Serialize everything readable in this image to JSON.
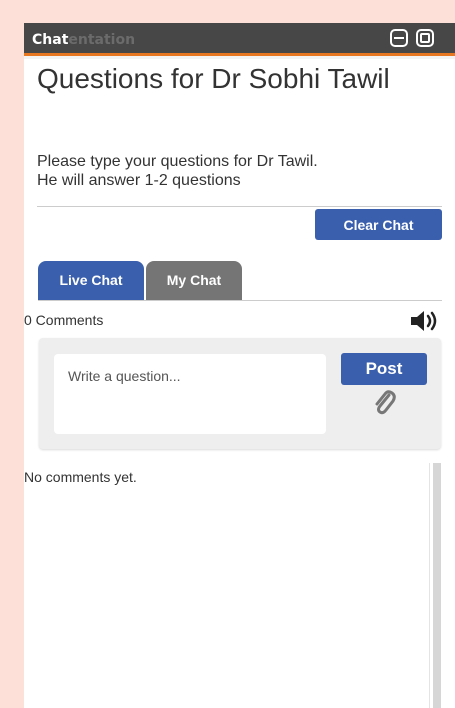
{
  "window": {
    "tab_label": "Chat",
    "tab_label_hidden": "entation",
    "minimize_icon": "minimize-icon",
    "maximize_icon": "maximize-icon"
  },
  "header": {
    "title": "Questions for Dr Sobhi Tawil",
    "description_line1": "Please type your questions for Dr Tawil.",
    "description_line2": "He will answer 1-2 questions"
  },
  "actions": {
    "clear_label": "Clear Chat"
  },
  "tabs": [
    {
      "label": "Live Chat",
      "active": true,
      "color": "#3a5fad"
    },
    {
      "label": "My Chat",
      "active": false,
      "color": "#757575"
    }
  ],
  "comments": {
    "count_text": "0 Comments",
    "sound_icon": "speaker-icon",
    "empty_text": "No comments yet."
  },
  "composer": {
    "placeholder": "Write a question...",
    "value": "",
    "post_label": "Post",
    "attach_icon": "paperclip-icon"
  },
  "colors": {
    "accent": "#3a5fad",
    "titlebar": "#474747",
    "titlebar_border": "#e87722",
    "page_bg": "#fde0d8"
  }
}
